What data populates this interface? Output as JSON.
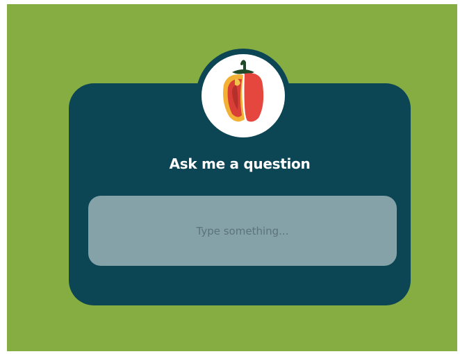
{
  "widget": {
    "title": "Ask me a question",
    "input_placeholder": "Type something...",
    "avatar_icon": "bell-pepper-icon"
  },
  "colors": {
    "background": "#86ad42",
    "card": "#0c4654",
    "input": "#85a2a8",
    "title_text": "#ffffff",
    "placeholder_text": "#5c7479"
  }
}
